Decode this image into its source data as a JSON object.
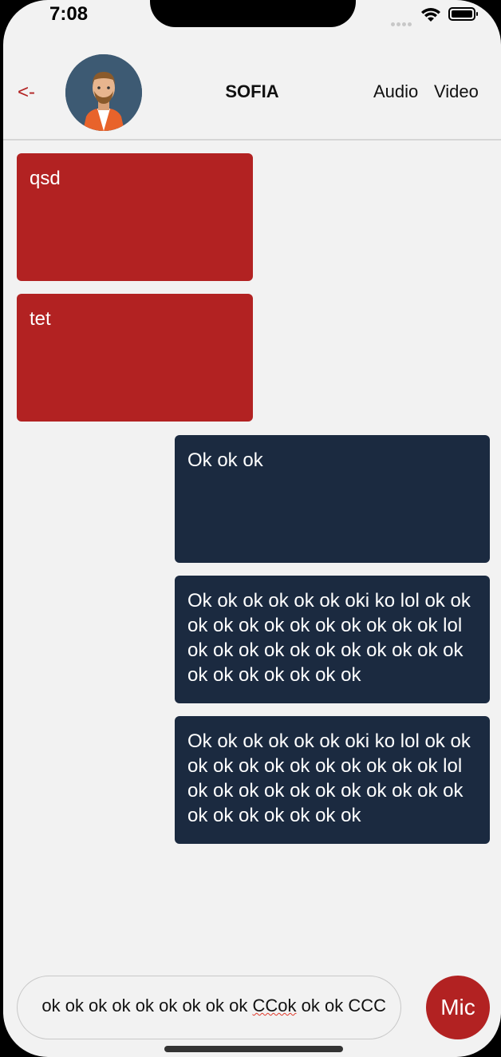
{
  "status_bar": {
    "time": "7:08"
  },
  "header": {
    "back_label": "<-",
    "contact_name": "SOFIA",
    "audio_label": "Audio",
    "video_label": "Video"
  },
  "messages": [
    {
      "direction": "incoming",
      "text": "qsd"
    },
    {
      "direction": "incoming",
      "text": "tet"
    },
    {
      "direction": "outgoing",
      "text": "Ok ok ok"
    },
    {
      "direction": "outgoing",
      "text": "Ok ok ok ok ok ok oki ko lol ok ok ok ok ok ok ok ok ok ok ok ok lol ok ok ok ok ok ok ok ok ok ok ok ok ok ok ok ok ok ok"
    },
    {
      "direction": "outgoing",
      "text": "Ok ok ok ok ok ok oki ko lol ok ok ok ok ok ok ok ok ok ok ok ok lol ok ok ok ok ok ok ok ok ok ok ok ok ok ok ok ok ok ok"
    }
  ],
  "composer": {
    "text_before": "ok ok ok ok ok ok ok ok ok ",
    "text_misspelled": "CCok",
    "text_after": " ok ok CCC"
  },
  "mic_label": "Mic",
  "colors": {
    "accent": "#b22222",
    "outgoing": "#1b2a40",
    "background": "#f2f2f2"
  }
}
